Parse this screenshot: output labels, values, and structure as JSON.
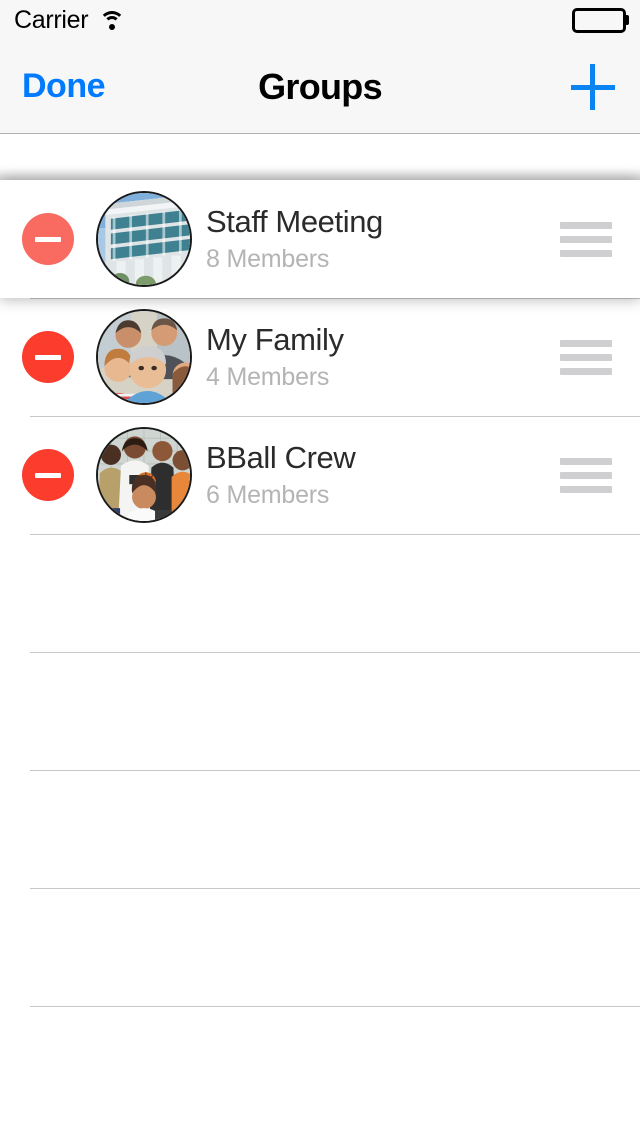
{
  "status_bar": {
    "carrier": "Carrier",
    "wifi_icon": "wifi-icon",
    "battery_icon": "battery-full-icon"
  },
  "nav_bar": {
    "done_label": "Done",
    "title": "Groups",
    "add_icon": "plus-icon",
    "tint_color": "#007AFF"
  },
  "colors": {
    "delete_red": "#FC3D2E",
    "delete_red_dragging": "#F96A60",
    "separator": "#C8C7CC",
    "reorder_gray": "#CFCFD2",
    "subtitle_gray": "#B4B4B4",
    "nav_background": "#F7F7F7"
  },
  "list": {
    "edit_mode": true,
    "delete_icon": "minus-circle-icon",
    "reorder_icon": "reorder-handle-icon",
    "rows": [
      {
        "title": "Staff Meeting",
        "subtitle": "8 Members",
        "avatar": "office-building-photo",
        "dragging": true
      },
      {
        "title": "My Family",
        "subtitle": "4 Members",
        "avatar": "family-group-photo",
        "dragging": false
      },
      {
        "title": "BBall Crew",
        "subtitle": "6 Members",
        "avatar": "basketball-team-photo",
        "dragging": false
      }
    ],
    "empty_row_count": 5
  }
}
